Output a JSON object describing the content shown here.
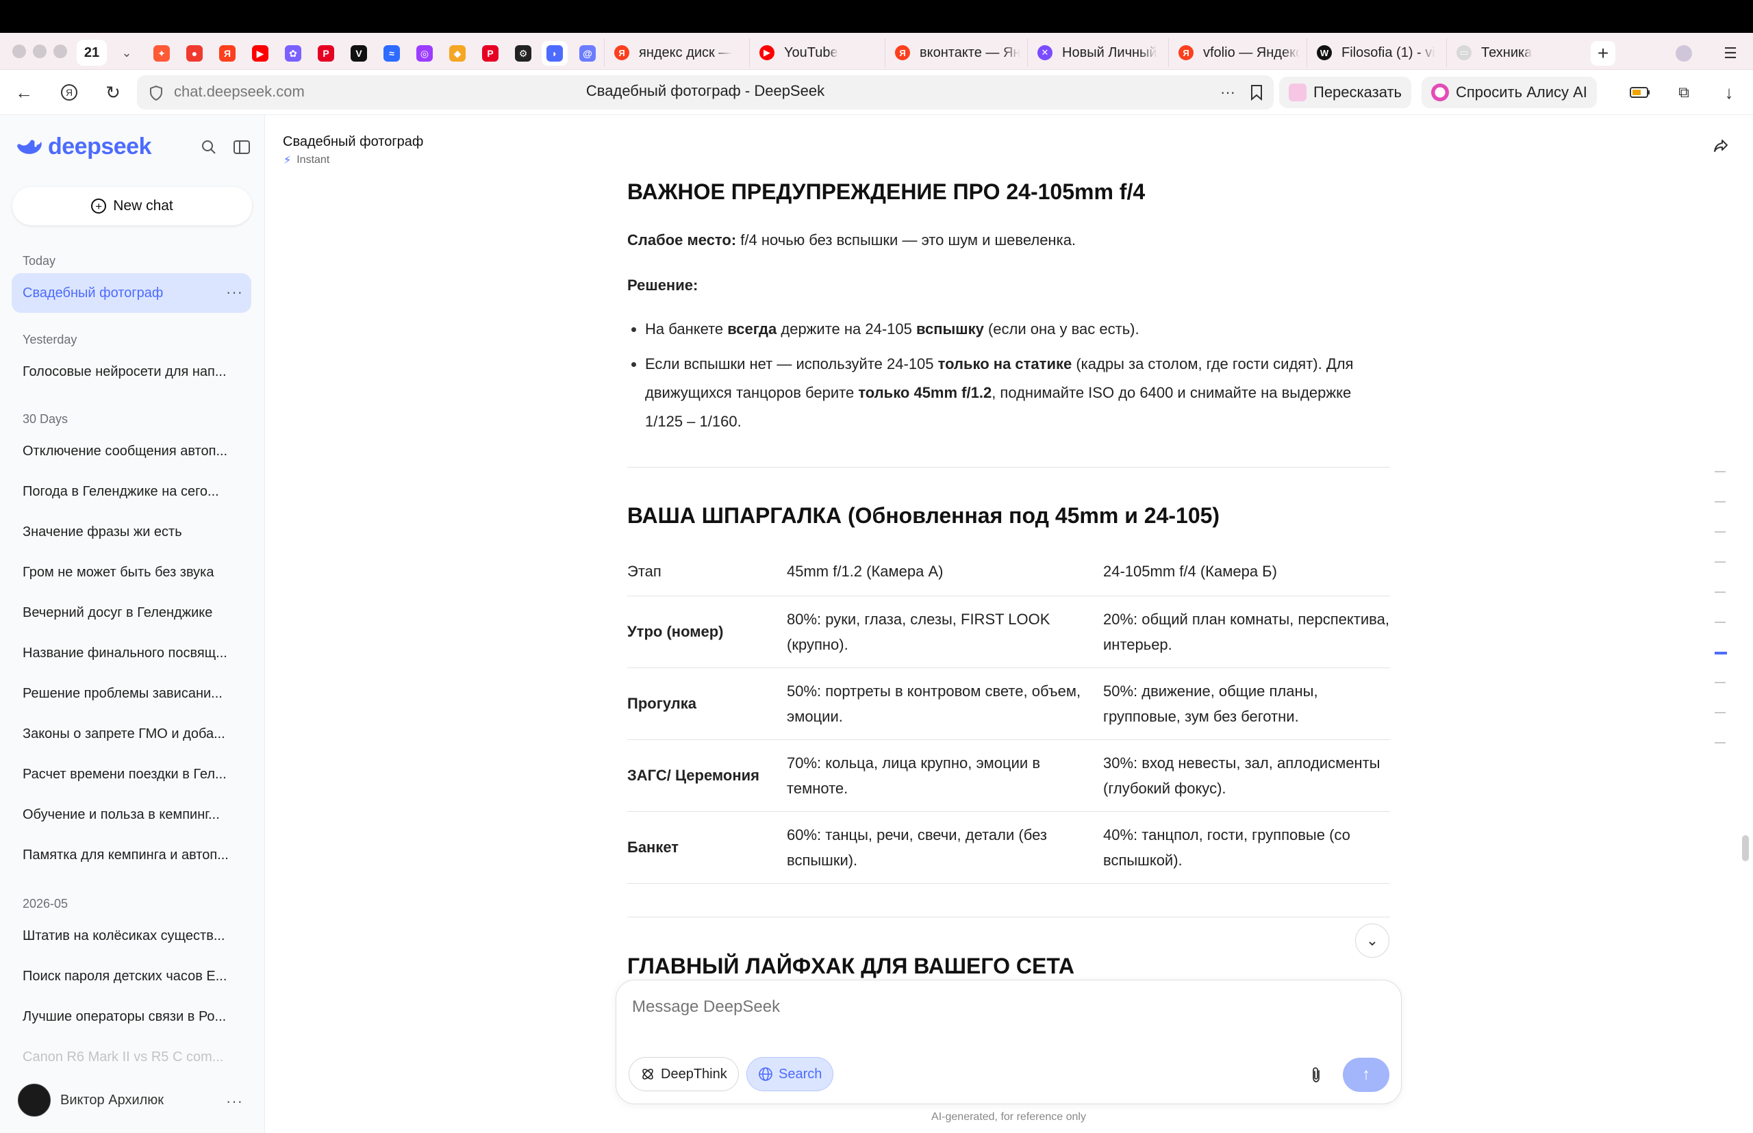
{
  "browser": {
    "tab_counter": "21",
    "pinned_tabs": [
      {
        "name": "yandex-services-icon",
        "color": "#ff5a36",
        "glyph": "✦"
      },
      {
        "name": "map-pin-icon",
        "color": "#f03a2f",
        "glyph": "●"
      },
      {
        "name": "yandex-icon",
        "color": "#fc3f1d",
        "glyph": "Я"
      },
      {
        "name": "youtube-icon",
        "color": "#ff0000",
        "glyph": "▶"
      },
      {
        "name": "figma-icon",
        "color": "#7b61ff",
        "glyph": "✿"
      },
      {
        "name": "pinterest-icon",
        "color": "#e60023",
        "glyph": "P"
      },
      {
        "name": "vimeo-icon",
        "color": "#111111",
        "glyph": "V"
      },
      {
        "name": "blue-app-icon",
        "color": "#2e6bff",
        "glyph": "≈"
      },
      {
        "name": "purple-app-icon",
        "color": "#9b3cff",
        "glyph": "◎"
      },
      {
        "name": "yellow-app-icon",
        "color": "#f5a623",
        "glyph": "◆"
      },
      {
        "name": "pinterest-icon",
        "color": "#e60023",
        "glyph": "P"
      },
      {
        "name": "gear-app-icon",
        "color": "#222222",
        "glyph": "⚙"
      },
      {
        "name": "deepseek-icon",
        "color": "#4d6bfe",
        "glyph": "◗"
      },
      {
        "name": "at-sign-icon",
        "color": "#6b7cff",
        "glyph": "@"
      }
    ],
    "tabs": [
      {
        "title": "яндекс диск — ",
        "fav": "Я",
        "color": "#fc3f1d"
      },
      {
        "title": "YouTube",
        "fav": "▶",
        "color": "#ff0000"
      },
      {
        "title": "вконтакте — Ян",
        "fav": "Я",
        "color": "#fc3f1d"
      },
      {
        "title": "Новый Личный",
        "fav": "✕",
        "color": "#7b4cff"
      },
      {
        "title": "vfolio — Яндекс",
        "fav": "Я",
        "color": "#fc3f1d"
      },
      {
        "title": "Filosofia (1) - vi",
        "fav": "W",
        "color": "#111111"
      },
      {
        "title": "Техника",
        "fav": "▭",
        "color": "#d8d8d8"
      }
    ],
    "url": "chat.deepseek.com",
    "page_title": "Свадебный фотограф - DeepSeek",
    "retell_label": "Пересказать",
    "alice_label": "Спросить Алису AI"
  },
  "sidebar": {
    "logo": "deepseek",
    "new_chat": "New chat",
    "groups": [
      {
        "label": "Today",
        "items": [
          "Свадебный фотограф"
        ]
      },
      {
        "label": "Yesterday",
        "items": [
          "Голосовые нейросети для нап..."
        ]
      },
      {
        "label": "30 Days",
        "items": [
          "Отключение сообщения автоп...",
          "Погода в Геленджике на сего...",
          "Значение фразы жи есть",
          "Гром не может быть без звука",
          "Вечерний досуг в Геленджике",
          "Название финального посвящ...",
          "Решение проблемы зависани...",
          "Законы о запрете ГМО и доба...",
          "Расчет времени поездки в Гел...",
          "Обучение и польза в кемпинг...",
          "Памятка для кемпинга и автоп..."
        ]
      },
      {
        "label": "2026-05",
        "items": [
          "Штатив на колёсиках существ...",
          "Поиск пароля детских часов Е...",
          "Лучшие операторы связи в Ро...",
          "Canon R6 Mark II vs R5 C com..."
        ]
      }
    ],
    "user_name": "Виктор Архилюк"
  },
  "chat": {
    "title": "Свадебный фотограф",
    "mode": "Instant",
    "section1_title": "ВАЖНОЕ ПРЕДУПРЕЖДЕНИЕ ПРО 24-105mm f/4",
    "weak_label": "Слабое место:",
    "weak_text": " f/4 ночью без вспышки — это шум и шевеленка.",
    "solution_label": "Решение:",
    "b1_a": "На банкете ",
    "b1_b": "всегда",
    "b1_c": " держите на 24-105 ",
    "b1_d": "вспышку",
    "b1_e": " (если она у вас есть).",
    "b2_a": "Если вспышки нет — используйте 24-105 ",
    "b2_b": "только на статике",
    "b2_c": " (кадры за столом, где гости сидят). Для движущихся танцоров берите ",
    "b2_d": "только 45mm f/1.2",
    "b2_e": ", поднимайте ISO до 6400 и снимайте на выдержке 1/125 – 1/160.",
    "section2_title": "ВАША ШПАРГАЛКА (Обновленная под 45mm и 24-105)",
    "table": {
      "headers": [
        "Этап",
        "45mm f/1.2 (Камера А)",
        "24-105mm f/4 (Камера Б)"
      ],
      "rows": [
        [
          "Утро (номер)",
          "80%: руки, глаза, слезы, FIRST LOOK (крупно).",
          "20%: общий план комнаты, перспектива, интерьер."
        ],
        [
          "Прогулка",
          "50%: портреты в контровом свете, объем, эмоции.",
          "50%: движение, общие планы, групповые, зум без беготни."
        ],
        [
          "ЗАГС/ Церемония",
          "70%: кольца, лица крупно, эмоции в темноте.",
          "30%: вход невесты, зал, аплодисменты (глубокий фокус)."
        ],
        [
          "Банкет",
          "60%: танцы, речи, свечи, детали (без вспышки).",
          "40%: танцпол, гости, групповые (со вспышкой)."
        ]
      ]
    },
    "section3_title": "ГЛАВНЫЙ ЛАЙФХАК ДЛЯ ВАШЕГО СЕТА"
  },
  "composer": {
    "placeholder": "Message DeepSeek",
    "deepthink": "DeepThink",
    "search": "Search"
  },
  "footer_note": "AI-generated, for reference only",
  "colors": {
    "accent": "#4d6bfe",
    "active_bg": "#dbe5ff",
    "tabstrip": "#f7eef2"
  }
}
